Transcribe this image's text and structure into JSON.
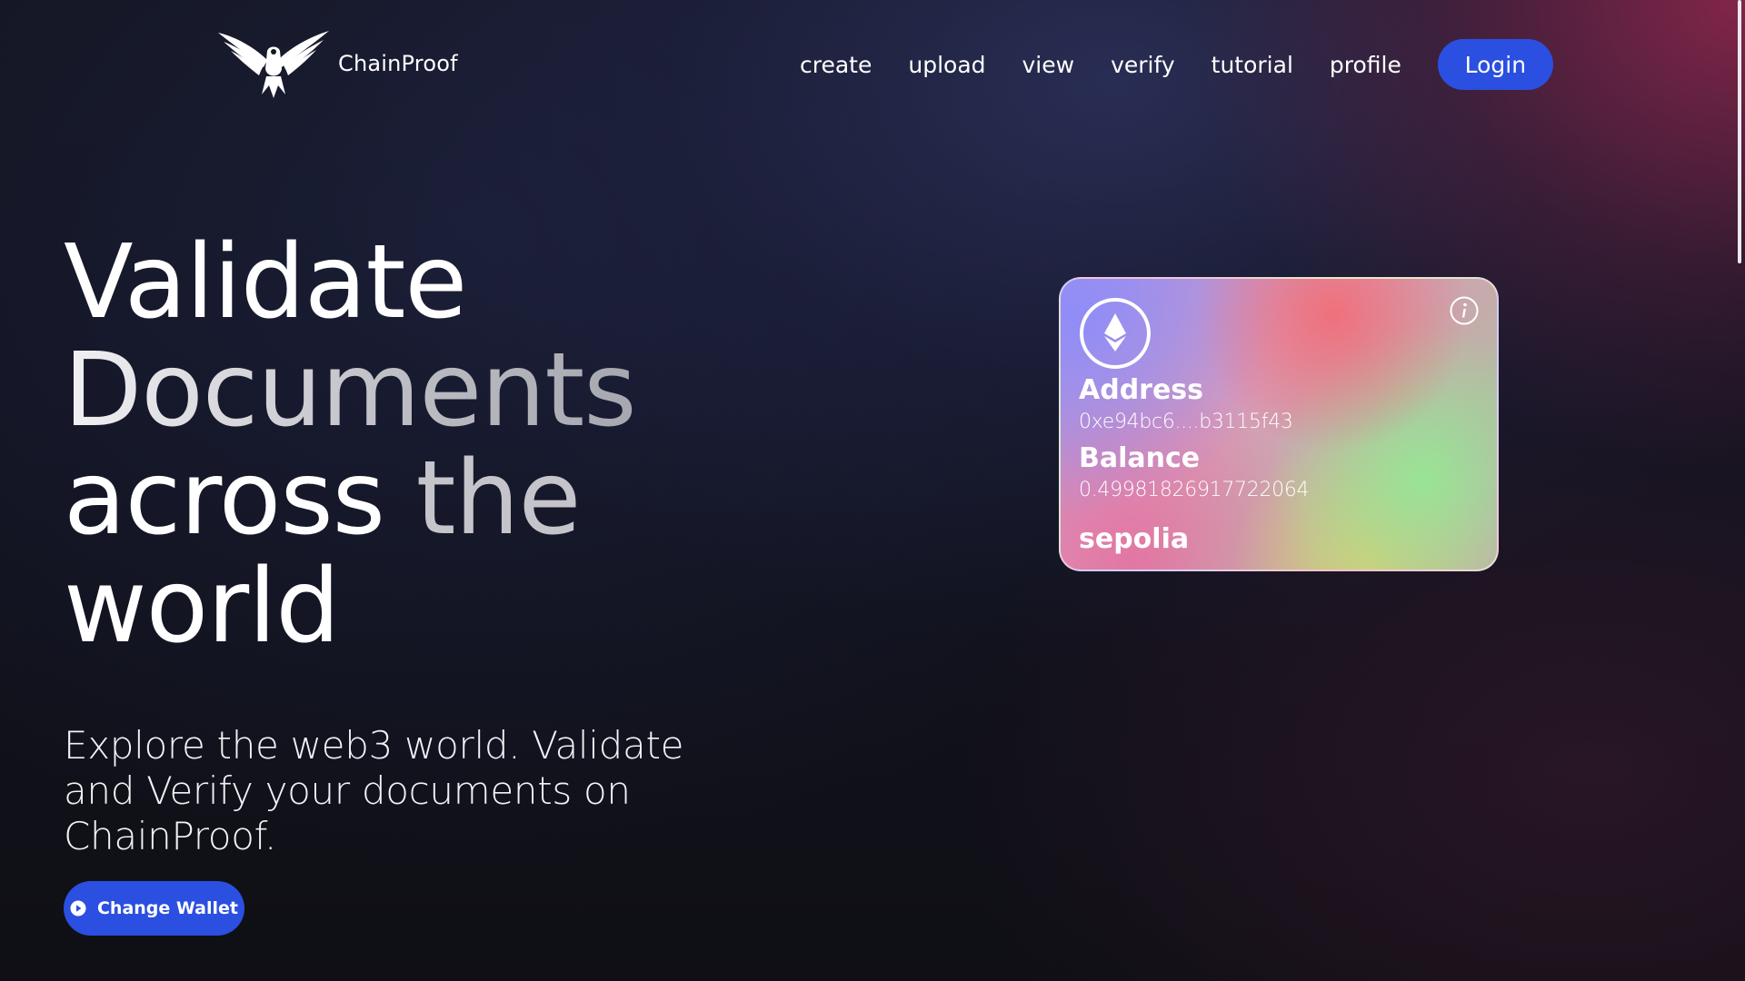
{
  "brand": {
    "name": "ChainProof",
    "logo_icon": "eagle-logo-icon"
  },
  "nav": {
    "items": [
      {
        "label": "create"
      },
      {
        "label": "upload"
      },
      {
        "label": "view"
      },
      {
        "label": "verify"
      },
      {
        "label": "tutorial"
      },
      {
        "label": "profile"
      }
    ],
    "login_label": "Login"
  },
  "hero": {
    "title_words": [
      "Validate",
      "Documents",
      "across",
      "the",
      "world"
    ],
    "subtitle": "Explore the web3 world. Validate and Verify your documents on ChainProof.",
    "cta_label": "Change Wallet",
    "cta_icon": "play-circle-icon"
  },
  "wallet_card": {
    "network_icon": "ethereum-icon",
    "info_icon": "info-icon",
    "address_label": "Address",
    "address_value": "0xe94bc6....b3115f43",
    "balance_label": "Balance",
    "balance_value": "0.49981826917722064",
    "network_name": "sepolia"
  },
  "colors": {
    "accent": "#2b4fe0",
    "background": "#0f0f14"
  }
}
